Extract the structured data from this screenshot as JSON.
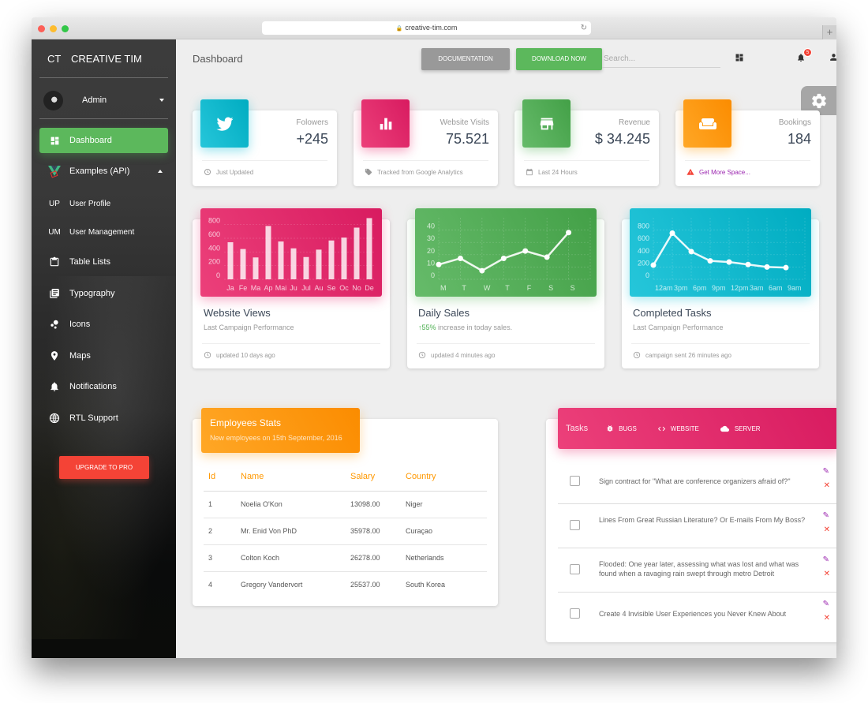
{
  "browser": {
    "url": "creative-tim.com",
    "new_tab": "+"
  },
  "sidebar": {
    "logo_mini": "CT",
    "logo_text": "CREATIVE TIM",
    "user": {
      "name": "Admin"
    },
    "items": [
      {
        "label": "Dashboard",
        "icon": "dashboard-icon",
        "active": true
      },
      {
        "label": "Examples (API)",
        "icon": "vue-laravel-icon",
        "expanded": true
      },
      {
        "label": "User Profile",
        "abbr": "UP"
      },
      {
        "label": "User Management",
        "abbr": "UM"
      },
      {
        "label": "Table Lists",
        "icon": "clipboard-icon"
      },
      {
        "label": "Typography",
        "icon": "library-books-icon"
      },
      {
        "label": "Icons",
        "icon": "bubble-chart-icon"
      },
      {
        "label": "Maps",
        "icon": "location-pin-icon"
      },
      {
        "label": "Notifications",
        "icon": "bell-icon"
      },
      {
        "label": "RTL Support",
        "icon": "language-globe-icon"
      }
    ],
    "upgrade_label": "UPGRADE TO PRO"
  },
  "topbar": {
    "title": "Dashboard",
    "documentation_label": "DOCUMENTATION",
    "download_label": "DOWNLOAD NOW",
    "search_placeholder": "Search...",
    "notification_count": "5"
  },
  "stats": [
    {
      "label": "Folowers",
      "value": "+245",
      "footer": "Just Updated",
      "footer_icon": "update-icon",
      "icon": "twitter-icon",
      "color": "#26c6da"
    },
    {
      "label": "Website Visits",
      "value": "75.521",
      "footer": "Tracked from Google Analytics",
      "footer_icon": "tag-icon",
      "icon": "bar-chart-icon",
      "color": "#ec407a"
    },
    {
      "label": "Revenue",
      "value": "$ 34.245",
      "footer": "Last 24 Hours",
      "footer_icon": "calendar-icon",
      "icon": "store-icon",
      "color": "#66bb6a"
    },
    {
      "label": "Bookings",
      "value": "184",
      "footer": "Get More Space...",
      "footer_icon": "warning-icon",
      "icon": "weekend-sofa-icon",
      "color": "#ffa726"
    }
  ],
  "chart_cards": [
    {
      "title": "Website Views",
      "subtitle": "Last Campaign Performance",
      "footer": "updated 10 days ago"
    },
    {
      "title": "Daily Sales",
      "subtitle_highlight": "55%",
      "subtitle_rest": " increase in today sales.",
      "footer": "updated 4 minutes ago"
    },
    {
      "title": "Completed Tasks",
      "subtitle": "Last Campaign Performance",
      "footer": "campaign sent 26 minutes ago"
    }
  ],
  "chart_data": [
    {
      "type": "bar",
      "title": "Website Views",
      "categories": [
        "Ja",
        "Fe",
        "Ma",
        "Ap",
        "Mai",
        "Ju",
        "Jul",
        "Au",
        "Se",
        "Oc",
        "No",
        "De"
      ],
      "values": [
        542,
        443,
        320,
        780,
        553,
        453,
        326,
        434,
        568,
        610,
        756,
        895
      ],
      "ylim": [
        0,
        900
      ],
      "yticks": [
        "0",
        "200",
        "400",
        "600",
        "800"
      ],
      "grid": true,
      "color": "#e91e63"
    },
    {
      "type": "line",
      "title": "Daily Sales",
      "categories": [
        "M",
        "T",
        "W",
        "T",
        "F",
        "S",
        "S"
      ],
      "values": [
        12,
        17,
        7,
        17,
        23,
        18,
        38
      ],
      "ylim": [
        0,
        50
      ],
      "yticks": [
        "0",
        "10",
        "20",
        "30",
        "40"
      ],
      "grid": true,
      "color": "#4caf50"
    },
    {
      "type": "line",
      "title": "Completed Tasks",
      "categories": [
        "12am",
        "3pm",
        "6pm",
        "9pm",
        "12pm",
        "3am",
        "6am",
        "9am"
      ],
      "values": [
        230,
        750,
        450,
        300,
        280,
        240,
        200,
        190
      ],
      "ylim": [
        0,
        1000
      ],
      "yticks": [
        "0",
        "200",
        "400",
        "600",
        "800"
      ],
      "grid": true,
      "color": "#00bcd4"
    }
  ],
  "employees": {
    "title": "Employees Stats",
    "subtitle": "New employees on 15th September, 2016",
    "columns": [
      "Id",
      "Name",
      "Salary",
      "Country"
    ],
    "rows": [
      [
        "1",
        "Noelia O'Kon",
        "13098.00",
        "Niger"
      ],
      [
        "2",
        "Mr. Enid Von PhD",
        "35978.00",
        "Curaçao"
      ],
      [
        "3",
        "Colton Koch",
        "26278.00",
        "Netherlands"
      ],
      [
        "4",
        "Gregory Vandervort",
        "25537.00",
        "South Korea"
      ]
    ]
  },
  "tasks": {
    "label": "Tasks",
    "tabs": [
      {
        "label": "BUGS",
        "icon": "bug-icon"
      },
      {
        "label": "WEBSITE",
        "icon": "code-icon"
      },
      {
        "label": "SERVER",
        "icon": "cloud-icon"
      }
    ],
    "items": [
      "Sign contract for \"What are conference organizers afraid of?\"",
      "Lines From Great Russian Literature? Or E-mails From My Boss?",
      "Flooded: One year later, assessing what was lost and what was found when a ravaging rain swept through metro Detroit",
      "Create 4 Invisible User Experiences you Never Knew About"
    ]
  }
}
